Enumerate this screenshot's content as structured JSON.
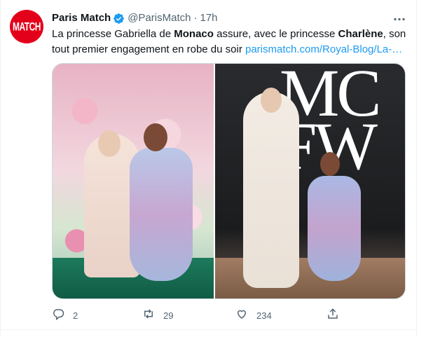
{
  "tweet": {
    "display_name": "Paris Match",
    "handle": "@ParisMatch",
    "separator": "·",
    "time": "17h",
    "text_part1": "La princesse Gabriella de ",
    "text_bold1": "Monaco",
    "text_part2": " assure, avec le princesse ",
    "text_bold2": "Charlène",
    "text_part3": ", son tout premier engagement en robe du soir ",
    "link": "parismatch.com/Royal-Blog/La-…"
  },
  "avatar": {
    "brand_text": "MATCH",
    "brand_color": "#e3001b"
  },
  "media": {
    "right_photo_logo": "MC\nFW"
  },
  "actions": {
    "reply_count": "2",
    "retweet_count": "29",
    "like_count": "234"
  },
  "icons": {
    "verified": "verified-badge-icon",
    "more": "more-icon",
    "reply": "reply-icon",
    "retweet": "retweet-icon",
    "like": "like-icon",
    "share": "share-icon"
  },
  "colors": {
    "accent": "#1d9bf0",
    "secondary_text": "#536471",
    "text": "#0f1419"
  }
}
